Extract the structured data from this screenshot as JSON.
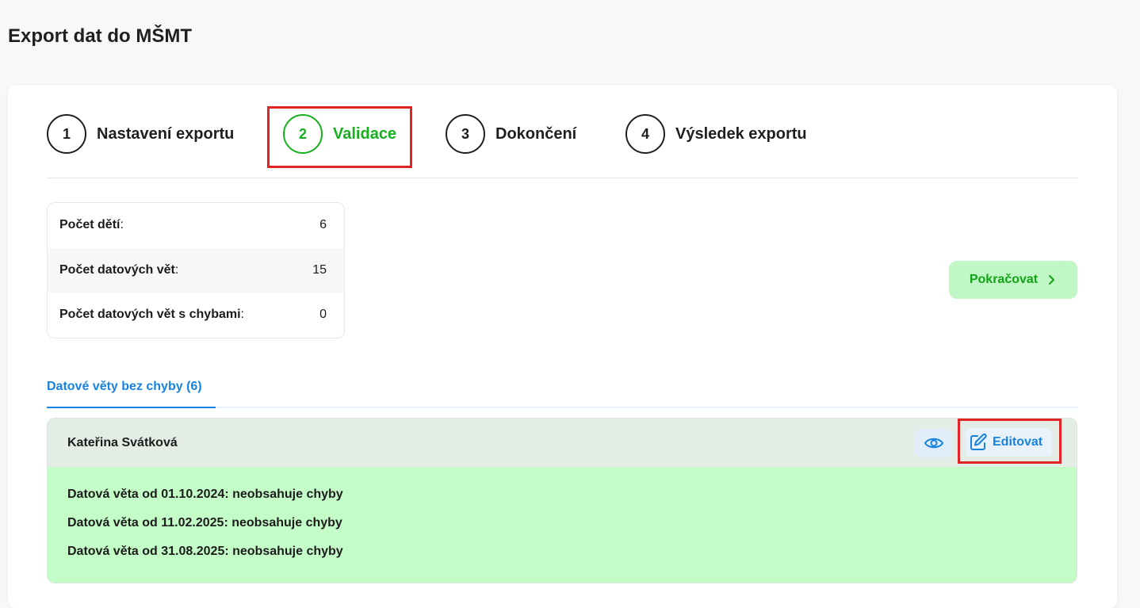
{
  "page": {
    "title": "Export dat do MŠMT"
  },
  "steps": [
    {
      "number": "1",
      "label": "Nastavení exportu",
      "active": false
    },
    {
      "number": "2",
      "label": "Validace",
      "active": true
    },
    {
      "number": "3",
      "label": "Dokončení",
      "active": false
    },
    {
      "number": "4",
      "label": "Výsledek exportu",
      "active": false
    }
  ],
  "stats": {
    "children_label": "Počet dětí",
    "children_value": "6",
    "records_label": "Počet datových vět",
    "records_value": "15",
    "errors_label": "Počet datových vět s chybami",
    "errors_value": "0",
    "colon": ":"
  },
  "actions": {
    "continue_label": "Pokračovat"
  },
  "tabs": [
    {
      "label": "Datové věty bez chyby (6)",
      "active": true
    }
  ],
  "record": {
    "name": "Kateřina Svátková",
    "edit_label": "Editovat",
    "lines": [
      "Datová věta od 01.10.2024: neobsahuje chyby",
      "Datová věta od 11.02.2025: neobsahuje chyby",
      "Datová věta od 31.08.2025: neobsahuje chyby"
    ]
  },
  "colors": {
    "accent_green": "#16b01d",
    "accent_blue": "#1783e0",
    "success_bg": "#c4fcc8",
    "highlight_red": "#e02424"
  },
  "icons": {
    "continue": "chevron-right-icon",
    "view": "eye-icon",
    "edit": "pencil-square-icon"
  }
}
